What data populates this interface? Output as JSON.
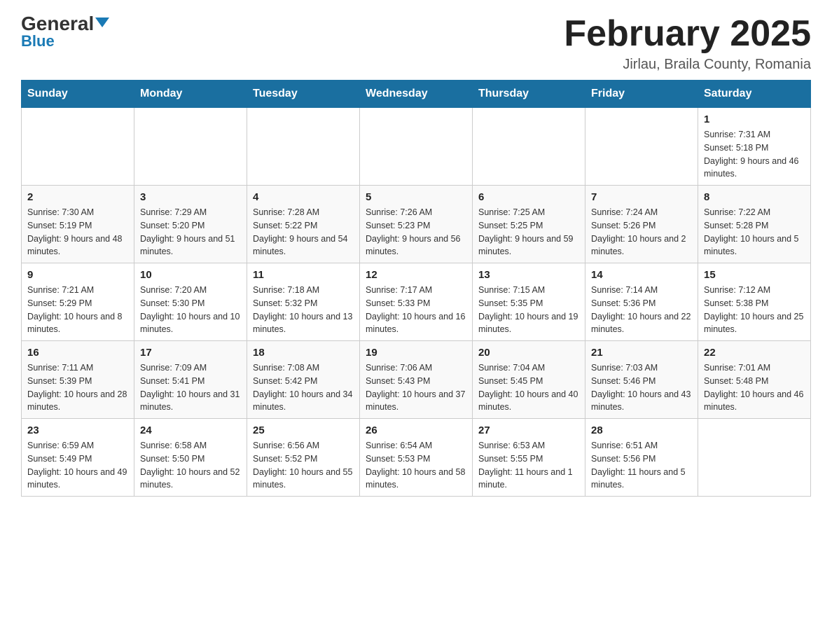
{
  "header": {
    "logo_general": "General",
    "logo_blue": "Blue",
    "month_title": "February 2025",
    "location": "Jirlau, Braila County, Romania"
  },
  "days_of_week": [
    "Sunday",
    "Monday",
    "Tuesday",
    "Wednesday",
    "Thursday",
    "Friday",
    "Saturday"
  ],
  "weeks": [
    {
      "days": [
        {
          "num": "",
          "info": ""
        },
        {
          "num": "",
          "info": ""
        },
        {
          "num": "",
          "info": ""
        },
        {
          "num": "",
          "info": ""
        },
        {
          "num": "",
          "info": ""
        },
        {
          "num": "",
          "info": ""
        },
        {
          "num": "1",
          "info": "Sunrise: 7:31 AM\nSunset: 5:18 PM\nDaylight: 9 hours and 46 minutes."
        }
      ]
    },
    {
      "days": [
        {
          "num": "2",
          "info": "Sunrise: 7:30 AM\nSunset: 5:19 PM\nDaylight: 9 hours and 48 minutes."
        },
        {
          "num": "3",
          "info": "Sunrise: 7:29 AM\nSunset: 5:20 PM\nDaylight: 9 hours and 51 minutes."
        },
        {
          "num": "4",
          "info": "Sunrise: 7:28 AM\nSunset: 5:22 PM\nDaylight: 9 hours and 54 minutes."
        },
        {
          "num": "5",
          "info": "Sunrise: 7:26 AM\nSunset: 5:23 PM\nDaylight: 9 hours and 56 minutes."
        },
        {
          "num": "6",
          "info": "Sunrise: 7:25 AM\nSunset: 5:25 PM\nDaylight: 9 hours and 59 minutes."
        },
        {
          "num": "7",
          "info": "Sunrise: 7:24 AM\nSunset: 5:26 PM\nDaylight: 10 hours and 2 minutes."
        },
        {
          "num": "8",
          "info": "Sunrise: 7:22 AM\nSunset: 5:28 PM\nDaylight: 10 hours and 5 minutes."
        }
      ]
    },
    {
      "days": [
        {
          "num": "9",
          "info": "Sunrise: 7:21 AM\nSunset: 5:29 PM\nDaylight: 10 hours and 8 minutes."
        },
        {
          "num": "10",
          "info": "Sunrise: 7:20 AM\nSunset: 5:30 PM\nDaylight: 10 hours and 10 minutes."
        },
        {
          "num": "11",
          "info": "Sunrise: 7:18 AM\nSunset: 5:32 PM\nDaylight: 10 hours and 13 minutes."
        },
        {
          "num": "12",
          "info": "Sunrise: 7:17 AM\nSunset: 5:33 PM\nDaylight: 10 hours and 16 minutes."
        },
        {
          "num": "13",
          "info": "Sunrise: 7:15 AM\nSunset: 5:35 PM\nDaylight: 10 hours and 19 minutes."
        },
        {
          "num": "14",
          "info": "Sunrise: 7:14 AM\nSunset: 5:36 PM\nDaylight: 10 hours and 22 minutes."
        },
        {
          "num": "15",
          "info": "Sunrise: 7:12 AM\nSunset: 5:38 PM\nDaylight: 10 hours and 25 minutes."
        }
      ]
    },
    {
      "days": [
        {
          "num": "16",
          "info": "Sunrise: 7:11 AM\nSunset: 5:39 PM\nDaylight: 10 hours and 28 minutes."
        },
        {
          "num": "17",
          "info": "Sunrise: 7:09 AM\nSunset: 5:41 PM\nDaylight: 10 hours and 31 minutes."
        },
        {
          "num": "18",
          "info": "Sunrise: 7:08 AM\nSunset: 5:42 PM\nDaylight: 10 hours and 34 minutes."
        },
        {
          "num": "19",
          "info": "Sunrise: 7:06 AM\nSunset: 5:43 PM\nDaylight: 10 hours and 37 minutes."
        },
        {
          "num": "20",
          "info": "Sunrise: 7:04 AM\nSunset: 5:45 PM\nDaylight: 10 hours and 40 minutes."
        },
        {
          "num": "21",
          "info": "Sunrise: 7:03 AM\nSunset: 5:46 PM\nDaylight: 10 hours and 43 minutes."
        },
        {
          "num": "22",
          "info": "Sunrise: 7:01 AM\nSunset: 5:48 PM\nDaylight: 10 hours and 46 minutes."
        }
      ]
    },
    {
      "days": [
        {
          "num": "23",
          "info": "Sunrise: 6:59 AM\nSunset: 5:49 PM\nDaylight: 10 hours and 49 minutes."
        },
        {
          "num": "24",
          "info": "Sunrise: 6:58 AM\nSunset: 5:50 PM\nDaylight: 10 hours and 52 minutes."
        },
        {
          "num": "25",
          "info": "Sunrise: 6:56 AM\nSunset: 5:52 PM\nDaylight: 10 hours and 55 minutes."
        },
        {
          "num": "26",
          "info": "Sunrise: 6:54 AM\nSunset: 5:53 PM\nDaylight: 10 hours and 58 minutes."
        },
        {
          "num": "27",
          "info": "Sunrise: 6:53 AM\nSunset: 5:55 PM\nDaylight: 11 hours and 1 minute."
        },
        {
          "num": "28",
          "info": "Sunrise: 6:51 AM\nSunset: 5:56 PM\nDaylight: 11 hours and 5 minutes."
        },
        {
          "num": "",
          "info": ""
        }
      ]
    }
  ]
}
